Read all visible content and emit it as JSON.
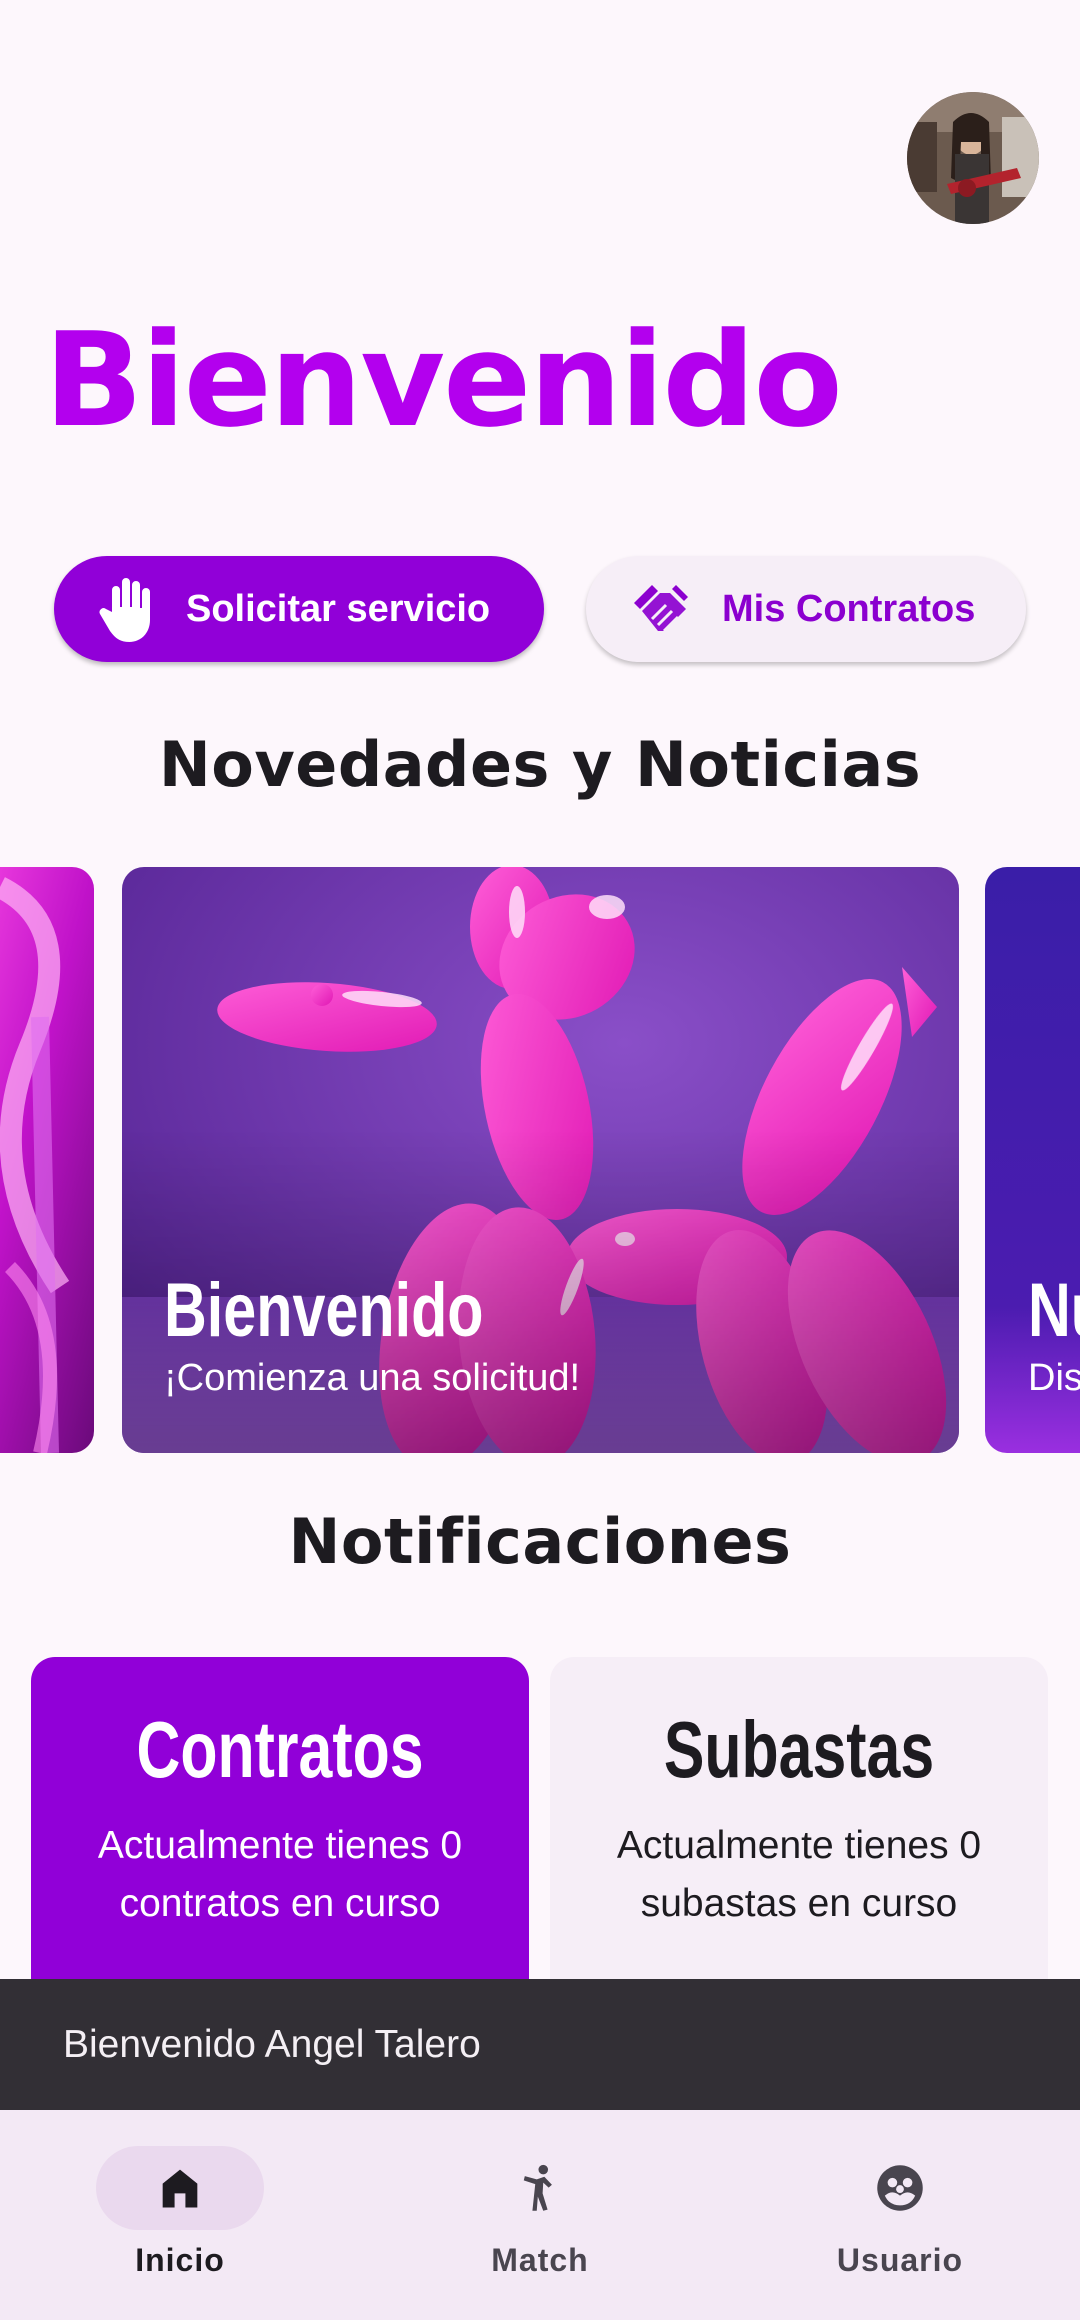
{
  "header": {
    "title": "Bienvenido",
    "avatar_icon": "user-avatar"
  },
  "actions": {
    "request_service": {
      "label": "Solicitar servicio",
      "icon": "hand-icon"
    },
    "my_contracts": {
      "label": "Mis Contratos",
      "icon": "handshake-icon"
    }
  },
  "news": {
    "heading": "Novedades y Noticias",
    "cards": [
      {
        "title": "",
        "subtitle": ""
      },
      {
        "title": "Bienvenido",
        "subtitle": "¡Comienza una solicitud!"
      },
      {
        "title": "Nu",
        "subtitle": "Dis"
      }
    ]
  },
  "notifications": {
    "heading": "Notificaciones",
    "contracts": {
      "title": "Contratos",
      "body": "Actualmente tienes 0 contratos en curso"
    },
    "auctions": {
      "title": "Subastas",
      "body": "Actualmente tienes 0 subastas en curso"
    }
  },
  "snackbar": {
    "message": "Bienvenido Angel Talero"
  },
  "bottom_nav": {
    "items": [
      {
        "label": "Inicio",
        "icon": "home-icon",
        "active": true
      },
      {
        "label": "Match",
        "icon": "person-dance-icon",
        "active": false
      },
      {
        "label": "Usuario",
        "icon": "group-icon",
        "active": false
      }
    ]
  },
  "colors": {
    "primary": "#9100d8",
    "title": "#b300ee",
    "background": "#fdf7fc",
    "surface_variant": "#f6eef7",
    "snackbar": "#322f35"
  }
}
